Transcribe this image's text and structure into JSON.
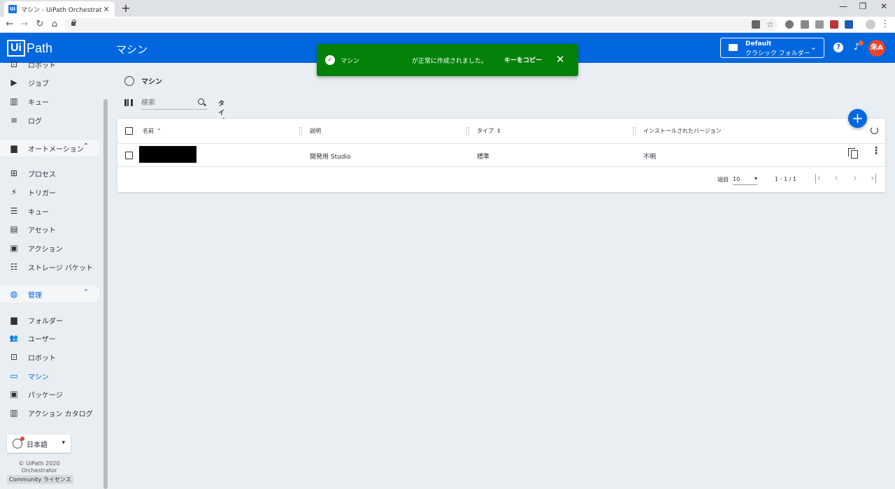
{
  "browser": {
    "tab_title": "マシン - UiPath Orchestrator",
    "tab_close": "✕",
    "new_tab": "+",
    "win_min": "—",
    "win_restore": "❐",
    "win_close": "✕",
    "nav_back": "←",
    "nav_forward": "→",
    "nav_reload": "↻",
    "nav_home": "⌂"
  },
  "header": {
    "logo_box": "Ui",
    "logo_text": "Path",
    "title": "マシン",
    "folder_line1": "Default",
    "folder_line2": "クラシック フォルダー",
    "folder_chevron": "⌄",
    "help": "?",
    "bell": "🔔",
    "avatar": "朱A"
  },
  "sidebar": {
    "items": [
      {
        "label": "ロボット",
        "icon": "robot-icon",
        "glyph": "⊡"
      },
      {
        "label": "ジョブ",
        "icon": "play-circle-icon",
        "glyph": "▶"
      },
      {
        "label": "キュー",
        "icon": "chart-icon",
        "glyph": "▥"
      },
      {
        "label": "ログ",
        "icon": "list-icon",
        "glyph": "≡"
      },
      {
        "label": "オートメーション",
        "icon": "folder-icon",
        "glyph": "▆",
        "caret": "⌃"
      },
      {
        "label": "プロセス",
        "icon": "tree-icon",
        "glyph": "⊞"
      },
      {
        "label": "トリガー",
        "icon": "bolt-icon",
        "glyph": "⚡"
      },
      {
        "label": "キュー",
        "icon": "stack-icon",
        "glyph": "☰"
      },
      {
        "label": "アセット",
        "icon": "asset-icon",
        "glyph": "▤"
      },
      {
        "label": "アクション",
        "icon": "clipboard-icon",
        "glyph": "▣"
      },
      {
        "label": "ストレージ バケット",
        "icon": "storage-icon",
        "glyph": "☷"
      },
      {
        "label": "管理",
        "icon": "globe-icon",
        "glyph": "◍",
        "caret": "⌃"
      },
      {
        "label": "フォルダー",
        "icon": "folder-icon",
        "glyph": "▆"
      },
      {
        "label": "ユーザー",
        "icon": "users-icon",
        "glyph": "👥"
      },
      {
        "label": "ロボット",
        "icon": "robot-icon",
        "glyph": "⊡"
      },
      {
        "label": "マシン",
        "icon": "monitor-icon",
        "glyph": "▭"
      },
      {
        "label": "パッケージ",
        "icon": "package-icon",
        "glyph": "▣"
      },
      {
        "label": "アクション カタログ",
        "icon": "catalog-icon",
        "glyph": "▥"
      }
    ],
    "language": "日本語",
    "language_dd": "▾",
    "copyright": "© UiPath 2020",
    "product": "Orchestrator",
    "license": "Community ライセンス"
  },
  "main": {
    "breadcrumb": "マシン",
    "search_placeholder": "検索",
    "type_filter": "タイプ: すべて",
    "type_filter_chev": "⌄",
    "add": "+",
    "columns": [
      {
        "label": "名前",
        "sort": "⌃"
      },
      {
        "label": "説明",
        "sort": ""
      },
      {
        "label": "タイプ",
        "sort": "⇕"
      },
      {
        "label": "インストールされたバージョン",
        "sort": ""
      }
    ],
    "rows": [
      {
        "name": "",
        "description": "開発用 Studio",
        "type": "標準",
        "version": "不明"
      }
    ],
    "pager": {
      "items_label": "項目",
      "page_size": "10",
      "page_size_dd": "▾",
      "range": "1 - 1 / 1",
      "first": "|‹",
      "prev": "‹",
      "next": "›",
      "last": "›|"
    },
    "more": "⋮"
  },
  "toast": {
    "check": "✓",
    "message_prefix": "マシン",
    "message_suffix": "が正常に作成されました。",
    "copy_key": "キーをコピー",
    "close": "✕",
    "color": "#038108"
  },
  "colors": {
    "brand": "#0067df",
    "avatar": "#e8442f",
    "background": "#e9eef2"
  }
}
